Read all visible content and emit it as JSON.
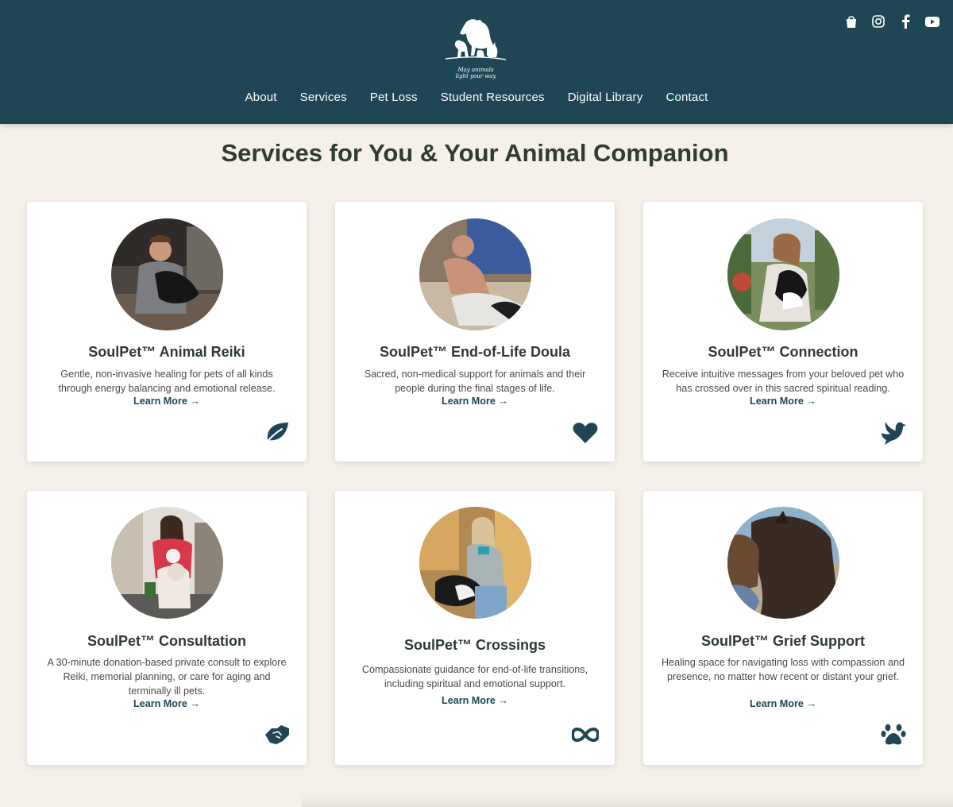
{
  "header": {
    "logo_tagline": "May animals\nlight your way",
    "background": "#1f4655",
    "social_icons": [
      "shopping-bag-icon",
      "instagram-icon",
      "facebook-icon",
      "youtube-icon"
    ],
    "nav": [
      "About",
      "Services",
      "Pet Loss",
      "Student Resources",
      "Digital Library",
      "Contact"
    ]
  },
  "main": {
    "title": "Services for You & Your Animal Companion",
    "accent_color": "#1f4655",
    "cards": [
      {
        "title": "SoulPet™ Animal Reiki",
        "description": "Gentle, non-invasive healing for pets of all kinds through energy balancing and emotional release.",
        "link": "Learn More →",
        "icon": "leaf-icon"
      },
      {
        "title": "SoulPet™ End-of-Life Doula",
        "description": "Sacred, non-medical support for animals and their people during the final stages of life.",
        "link": "Learn More →",
        "icon": "heart-icon"
      },
      {
        "title": "SoulPet™ Connection",
        "description": "Receive intuitive messages from your beloved pet who has crossed over in this sacred spiritual reading.",
        "link": "Learn More →",
        "icon": "dove-icon"
      },
      {
        "title": "SoulPet™ Consultation",
        "description": "A 30-minute donation-based private consult to explore Reiki, memorial planning, or care for aging and terminally ill pets.",
        "link": "Learn More →",
        "icon": "handshake-icon"
      },
      {
        "title": "SoulPet™ Crossings",
        "description": "Compassionate guidance for end-of-life transitions, including spiritual and emotional support.",
        "link": "Learn More →",
        "icon": "infinity-icon"
      },
      {
        "title": "SoulPet™ Grief Support",
        "description": "Healing space for navigating loss with compassion and presence, no matter how recent or distant your grief.",
        "link": "Learn More →",
        "icon": "paw-icon"
      }
    ]
  }
}
